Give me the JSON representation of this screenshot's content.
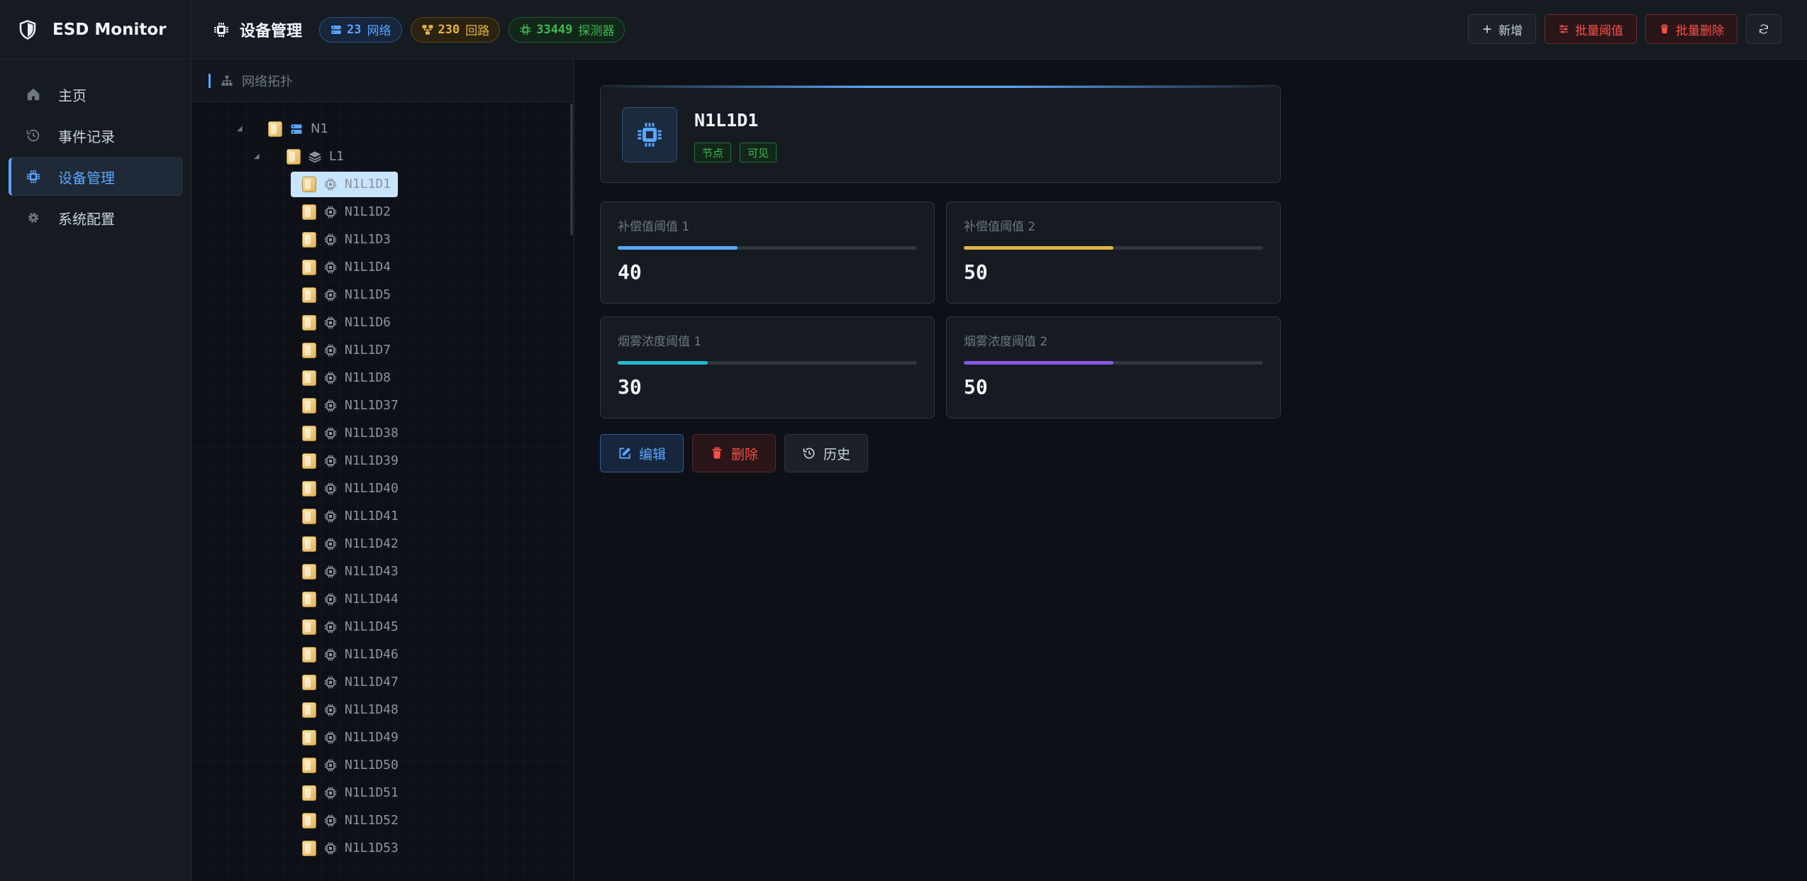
{
  "app": {
    "title": "ESD Monitor"
  },
  "sidebar": {
    "items": [
      {
        "label": "主页",
        "icon": "home-icon"
      },
      {
        "label": "事件记录",
        "icon": "history-icon"
      },
      {
        "label": "设备管理",
        "icon": "chip-icon",
        "active": true
      },
      {
        "label": "系统配置",
        "icon": "gear-icon"
      }
    ]
  },
  "header": {
    "title": "设备管理",
    "stats": [
      {
        "value": "23",
        "label": "网络",
        "color": "#58a6ff"
      },
      {
        "value": "230",
        "label": "回路",
        "color": "#e3b341"
      },
      {
        "value": "33449",
        "label": "探测器",
        "color": "#3fb950"
      }
    ],
    "buttons": {
      "add": "新增",
      "batch_threshold": "批量阈值",
      "batch_delete": "批量删除"
    }
  },
  "tree": {
    "title": "网络拓扑",
    "network": "N1",
    "loop": "L1",
    "devices": [
      "N1L1D1",
      "N1L1D2",
      "N1L1D3",
      "N1L1D4",
      "N1L1D5",
      "N1L1D6",
      "N1L1D7",
      "N1L1D8",
      "N1L1D37",
      "N1L1D38",
      "N1L1D39",
      "N1L1D40",
      "N1L1D41",
      "N1L1D42",
      "N1L1D43",
      "N1L1D44",
      "N1L1D45",
      "N1L1D46",
      "N1L1D47",
      "N1L1D48",
      "N1L1D49",
      "N1L1D50",
      "N1L1D51",
      "N1L1D52",
      "N1L1D53"
    ],
    "selected": "N1L1D1"
  },
  "detail": {
    "name": "N1L1D1",
    "tags": [
      "节点",
      "可见"
    ],
    "metrics": [
      {
        "label": "补偿值阈值 1",
        "value": "40",
        "fraction": 0.4,
        "color": "#58a6ff"
      },
      {
        "label": "补偿值阈值 2",
        "value": "50",
        "fraction": 0.5,
        "color": "#e3b341"
      },
      {
        "label": "烟雾浓度阈值 1",
        "value": "30",
        "fraction": 0.3,
        "color": "#22b8cf"
      },
      {
        "label": "烟雾浓度阈值 2",
        "value": "50",
        "fraction": 0.5,
        "color": "#8957e5"
      }
    ],
    "actions": {
      "edit": "编辑",
      "delete": "删除",
      "history": "历史"
    }
  }
}
